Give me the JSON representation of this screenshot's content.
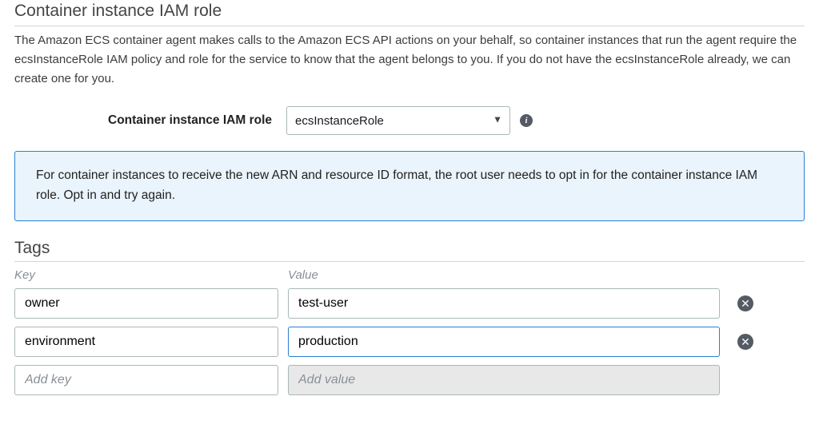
{
  "section1": {
    "title": "Container instance IAM role",
    "description": "The Amazon ECS container agent makes calls to the Amazon ECS API actions on your behalf, so container instances that run the agent require the ecsInstanceRole IAM policy and role for the service to know that the agent belongs to you. If you do not have the ecsInstanceRole already, we can create one for you.",
    "field_label": "Container instance IAM role",
    "field_value": "ecsInstanceRole",
    "info_glyph": "i"
  },
  "alert": {
    "text": "For container instances to receive the new ARN and resource ID format, the root user needs to opt in for the container instance IAM role. Opt in and try again."
  },
  "tags": {
    "title": "Tags",
    "key_header": "Key",
    "value_header": "Value",
    "rows": [
      {
        "key": "owner",
        "value": "test-user"
      },
      {
        "key": "environment",
        "value": "production"
      }
    ],
    "add_key_placeholder": "Add key",
    "add_value_placeholder": "Add value",
    "remove_glyph": "✕"
  }
}
